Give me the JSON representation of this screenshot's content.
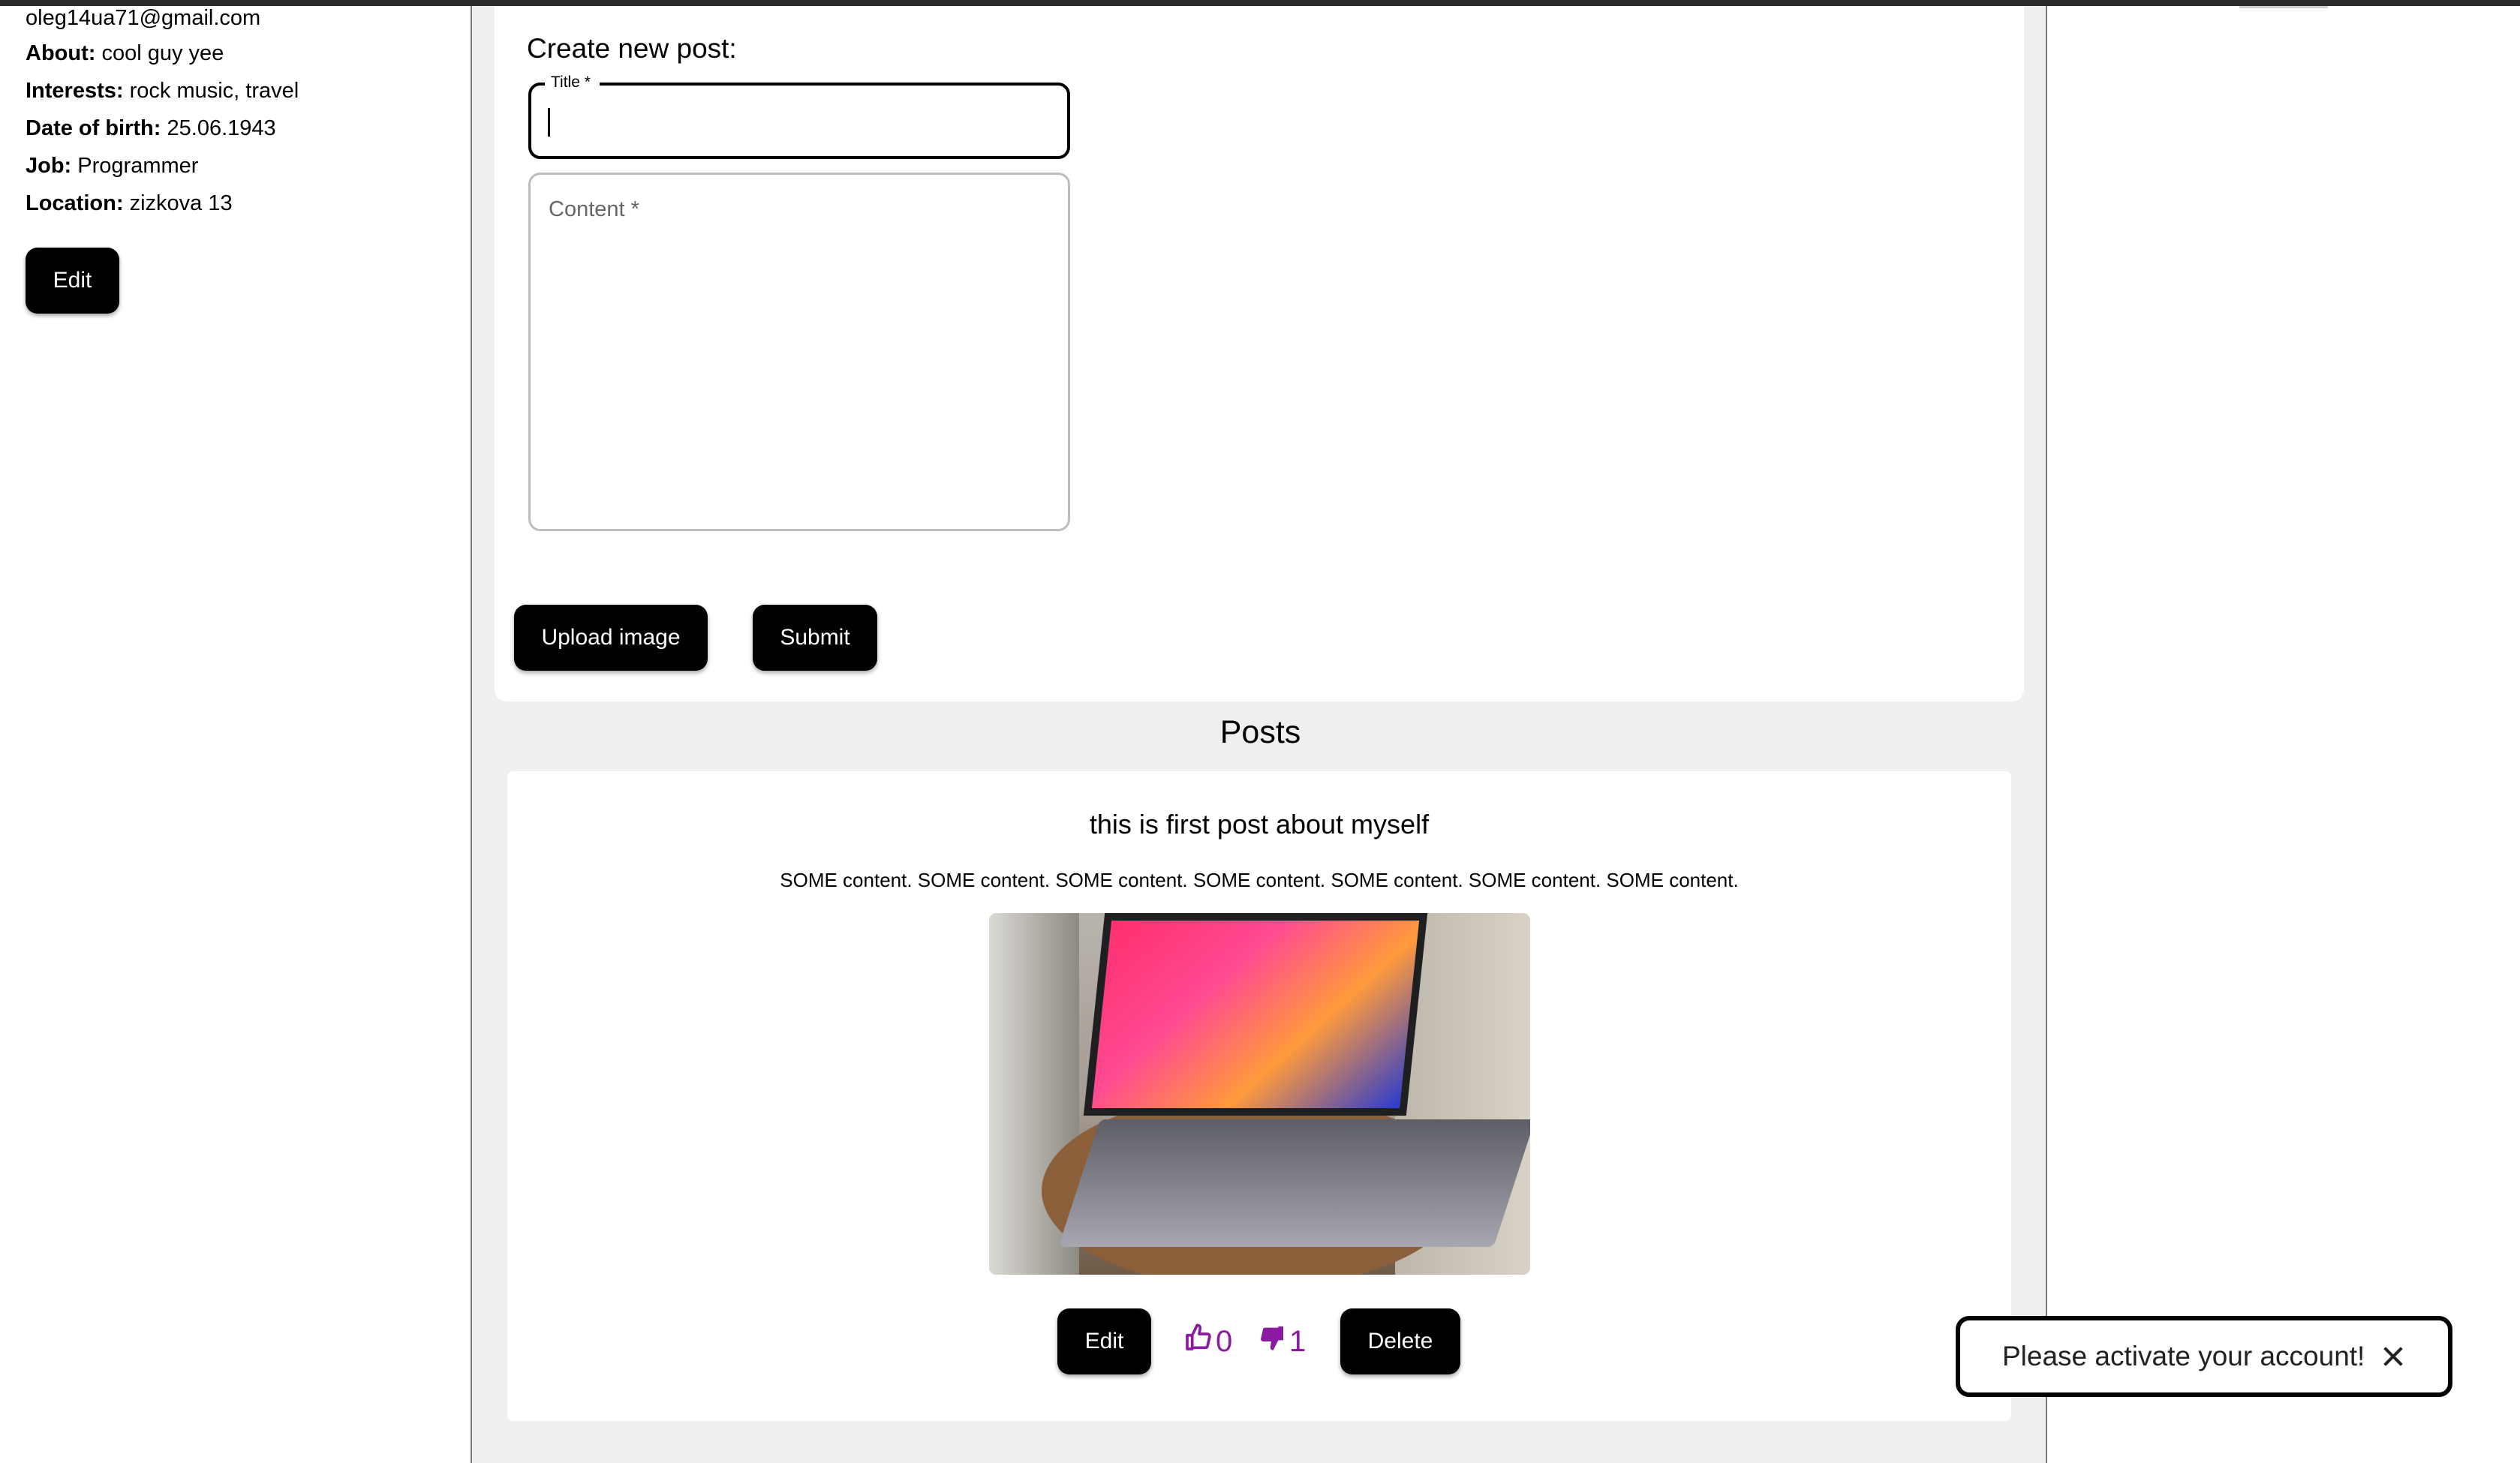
{
  "profile": {
    "email": "oleg14ua71@gmail.com",
    "about_label": "About:",
    "about_value": "cool guy yee",
    "interests_label": "Interests:",
    "interests_value": "rock music, travel",
    "dob_label": "Date of birth:",
    "dob_value": "25.06.1943",
    "job_label": "Job:",
    "job_value": "Programmer",
    "location_label": "Location:",
    "location_value": "zizkova 13",
    "edit_label": "Edit"
  },
  "create_post": {
    "heading": "Create new post:",
    "title_label": "Title *",
    "title_value": "",
    "content_placeholder": "Content *",
    "upload_label": "Upload image",
    "submit_label": "Submit"
  },
  "posts": {
    "heading": "Posts",
    "items": [
      {
        "title": "this is first post about myself",
        "content": "SOME content. SOME content. SOME content. SOME content. SOME content. SOME content. SOME content.",
        "image_icon": "laptop-photo",
        "edit_label": "Edit",
        "likes": "0",
        "dislikes": "1",
        "delete_label": "Delete",
        "like_icon": "thumbs-up-icon",
        "dislike_icon": "thumbs-down-icon",
        "reaction_color": "#8a1aa0"
      }
    ]
  },
  "toast": {
    "message": "Please activate your account!",
    "close_icon": "close-icon"
  }
}
